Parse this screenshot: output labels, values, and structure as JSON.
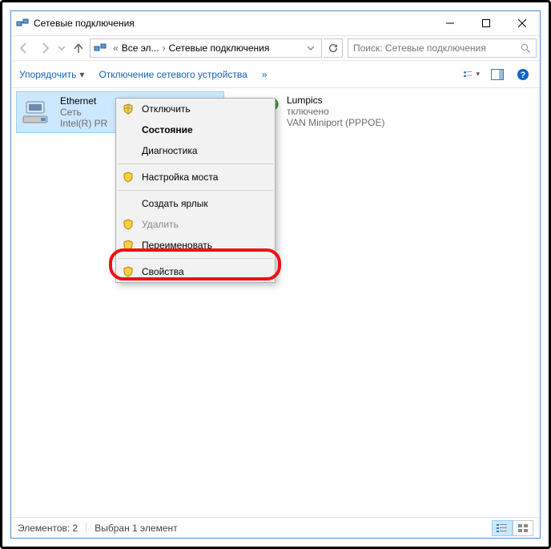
{
  "window": {
    "title": "Сетевые подключения"
  },
  "address": {
    "crumb1": "Все эл...",
    "crumb2": "Сетевые подключения"
  },
  "search": {
    "placeholder": "Поиск: Сетевые подключения"
  },
  "toolbar": {
    "organize": "Упорядочить",
    "disable_device": "Отключение сетевого устройства",
    "overflow": "»"
  },
  "connections": [
    {
      "name": "Ethernet",
      "line2": "Сеть",
      "line3": "Intel(R) PR"
    },
    {
      "name": "Lumpics",
      "line2": "тключено",
      "line3": "VAN Miniport (PPPOE)"
    }
  ],
  "context_menu": {
    "disable": "Отключить",
    "status": "Состояние",
    "diagnose": "Диагностика",
    "bridge": "Настройка моста",
    "shortcut": "Создать ярлык",
    "delete": "Удалить",
    "rename": "Переименовать",
    "properties": "Свойства"
  },
  "statusbar": {
    "count": "Элементов: 2",
    "selected": "Выбран 1 элемент"
  }
}
